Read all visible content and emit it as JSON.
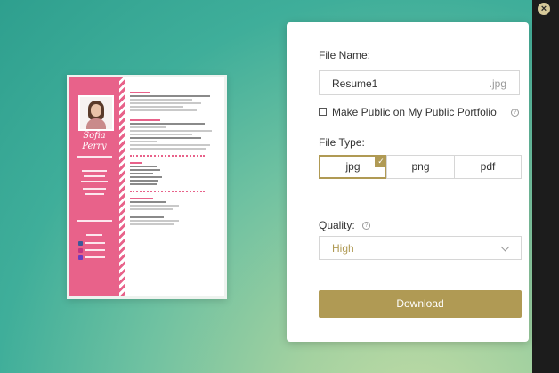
{
  "dialog": {
    "file_name_label": "File Name:",
    "file_name_value": "Resume1",
    "file_extension": ".jpg",
    "make_public_label": "Make Public on My Public Portfolio",
    "make_public_checked": false,
    "file_type_label": "File Type:",
    "file_types": [
      "jpg",
      "png",
      "pdf"
    ],
    "selected_file_type": "jpg",
    "quality_label": "Quality:",
    "quality_value": "High",
    "download_label": "Download",
    "close_glyph": "×",
    "help_glyph": "?",
    "check_glyph": "✓"
  },
  "resume": {
    "name": "Sofia Perry"
  },
  "colors": {
    "accent": "#b09a54",
    "resume_pink": "#e8628a",
    "background_teal": "#3fae9a"
  }
}
